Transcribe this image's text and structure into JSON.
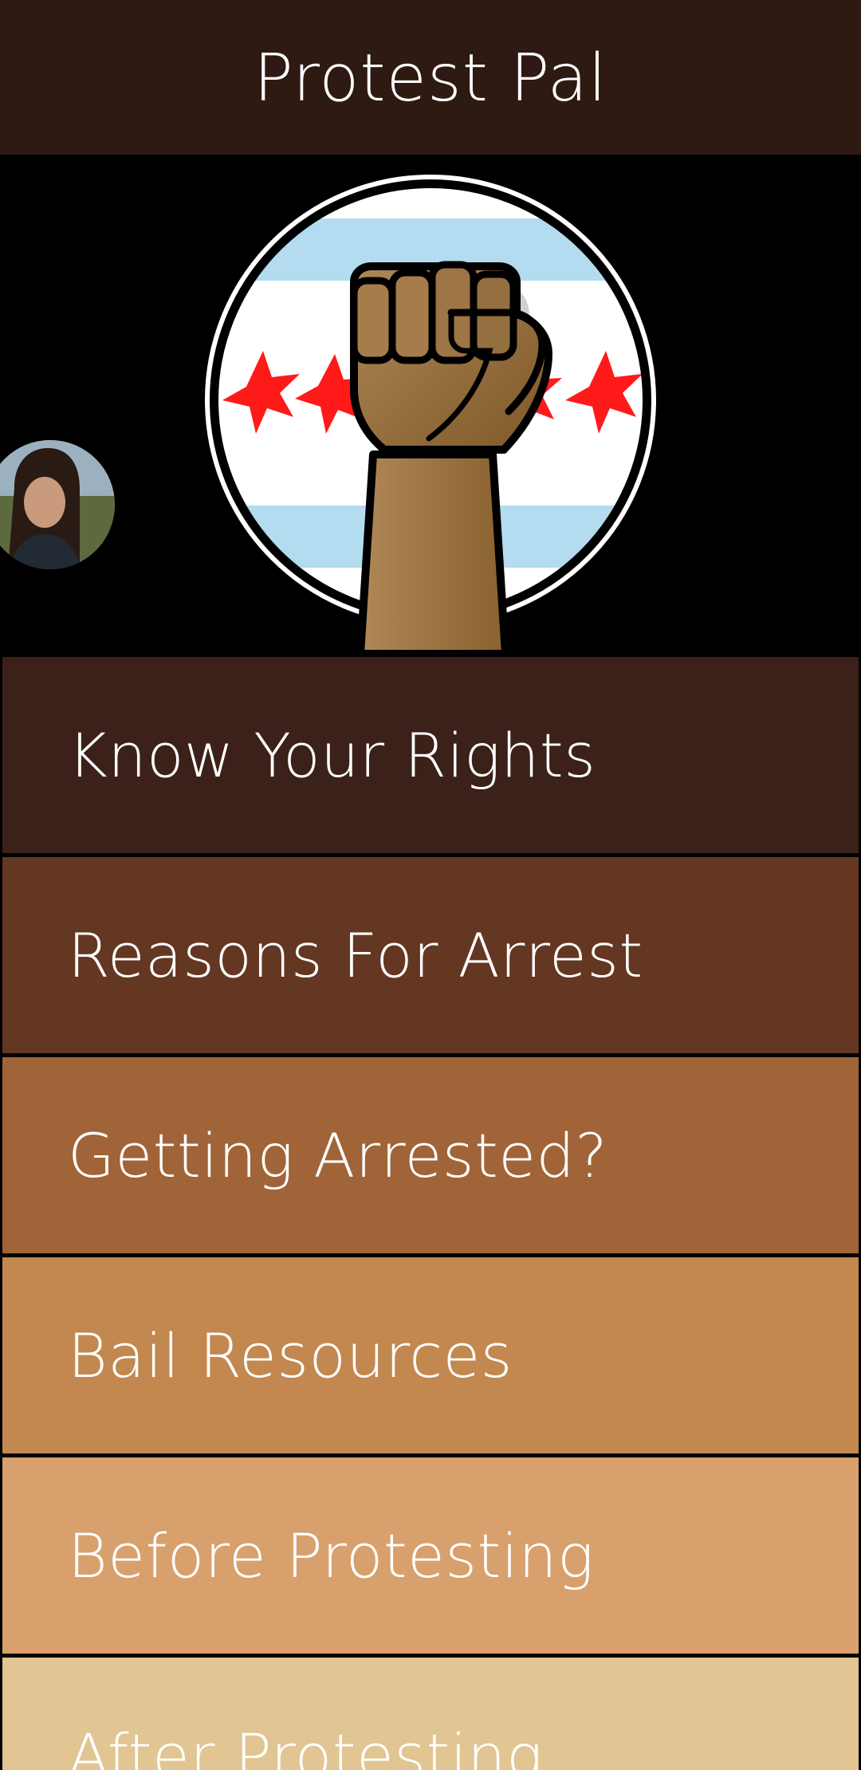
{
  "header": {
    "title": "Protest Pal"
  },
  "hero": {
    "logo_icon": "raised-fist-chicago-flag-icon",
    "avatar_icon": "user-avatar-photo"
  },
  "menu": {
    "items": [
      {
        "label": "Know Your Rights",
        "color": "#3b2119"
      },
      {
        "label": "Reasons For Arrest",
        "color": "#643722"
      },
      {
        "label": "Getting Arrested?",
        "color": "#a06438"
      },
      {
        "label": "Bail Resources",
        "color": "#c2884f"
      },
      {
        "label": "Before Protesting",
        "color": "#d8a06c"
      },
      {
        "label": "After Protesting",
        "color": "#e1c592"
      }
    ]
  },
  "colors": {
    "header_bg": "#2e1a12",
    "flag_blue": "#b3dcf0",
    "flag_red": "#ff1a1a",
    "fist_skin": "#9a7040"
  }
}
